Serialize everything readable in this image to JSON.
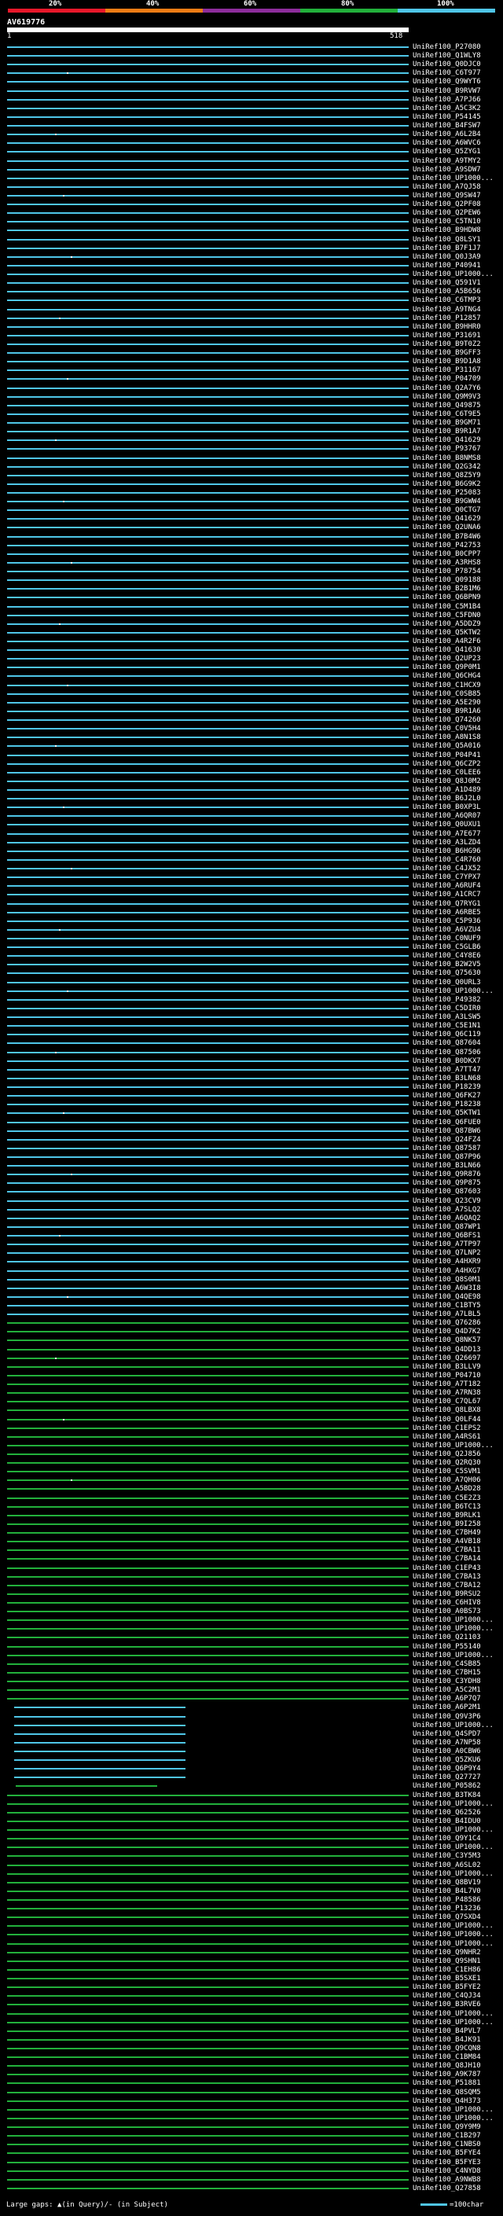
{
  "identity_scale": {
    "labels": [
      "20%",
      "40%",
      "60%",
      "80%",
      "100%"
    ],
    "colors": [
      "#e8182a",
      "#f07c15",
      "#8d2d9c",
      "#22b03b",
      "#4fc6e8"
    ]
  },
  "query": {
    "id": "AV619776",
    "start_label": "1",
    "end_label": "518"
  },
  "hits": [
    "UniRef100_P27080",
    "UniRef100_Q1WLY8",
    "UniRef100_Q0DJC0",
    "UniRef100_C6T977",
    "UniRef100_Q9WYT6",
    "UniRef100_B9RVW7",
    "UniRef100_A7PJ66",
    "UniRef100_A5C3K2",
    "UniRef100_P54145",
    "UniRef100_B4FSW7",
    "UniRef100_A6L2B4",
    "UniRef100_A6WVC6",
    "UniRef100_Q5ZYG1",
    "UniRef100_A9TMY2",
    "UniRef100_A9SDW7",
    "UniRef100_UP1000...",
    "UniRef100_A7QJ58",
    "UniRef100_Q9SW47",
    "UniRef100_Q2PF08",
    "UniRef100_Q2PEW6",
    "UniRef100_C5TN10",
    "UniRef100_B9HDW8",
    "UniRef100_Q8LSY1",
    "UniRef100_B7F1J7",
    "UniRef100_Q0J3A9",
    "UniRef100_P40941",
    "UniRef100_UP1000...",
    "UniRef100_Q591V1",
    "UniRef100_A5B656",
    "UniRef100_C6TMP3",
    "UniRef100_A9TNG4",
    "UniRef100_P12857",
    "UniRef100_B9HHR0",
    "UniRef100_P31691",
    "UniRef100_B9T0Z2",
    "UniRef100_B9GFF3",
    "UniRef100_B9D1A8",
    "UniRef100_P31167",
    "UniRef100_P04709",
    "UniRef100_Q2A7Y6",
    "UniRef100_Q9M9V3",
    "UniRef100_Q49875",
    "UniRef100_C6T9E5",
    "UniRef100_B9GM71",
    "UniRef100_B9R1A7",
    "UniRef100_Q41629",
    "UniRef100_P93767",
    "UniRef100_B8NMS8",
    "UniRef100_Q2G342",
    "UniRef100_Q8Z5Y9",
    "UniRef100_B6G9K2",
    "UniRef100_P25083",
    "UniRef100_B9GWW4",
    "UniRef100_Q0CTG7",
    "UniRef100_Q41629",
    "UniRef100_Q2UNA6",
    "UniRef100_B7B4W6",
    "UniRef100_P42753",
    "UniRef100_B0CPP7",
    "UniRef100_A3RHS8",
    "UniRef100_P78754",
    "UniRef100_Q09188",
    "UniRef100_B2B1M6",
    "UniRef100_Q6BPN9",
    "UniRef100_C5M1B4",
    "UniRef100_C5FDN0",
    "UniRef100_A5DDZ9",
    "UniRef100_Q5KTW2",
    "UniRef100_A4R2F6",
    "UniRef100_Q41630",
    "UniRef100_Q2UP23",
    "UniRef100_Q9P0M1",
    "UniRef100_Q6CHG4",
    "UniRef100_C1HCX9",
    "UniRef100_C0SB85",
    "UniRef100_A5E290",
    "UniRef100_B9R1A6",
    "UniRef100_Q74260",
    "UniRef100_C0V5H4",
    "UniRef100_A8N1S8",
    "UniRef100_Q5A016",
    "UniRef100_P04P41",
    "UniRef100_Q6CZP2",
    "UniRef100_C0LEE6",
    "UniRef100_Q8J0M2",
    "UniRef100_A1D489",
    "UniRef100_B6J2L0",
    "UniRef100_B0XP3L",
    "UniRef100_A6QR07",
    "UniRef100_Q0UXU1",
    "UniRef100_A7E677",
    "UniRef100_A3LZD4",
    "UniRef100_B6HG96",
    "UniRef100_C4R760",
    "UniRef100_C4JX52",
    "UniRef100_C7YPX7",
    "UniRef100_A6RUF4",
    "UniRef100_A1CRC7",
    "UniRef100_Q7RYG1",
    "UniRef100_A6RBE5",
    "UniRef100_C5P936",
    "UniRef100_A6VZU4",
    "UniRef100_C0NUF9",
    "UniRef100_C5GLB6",
    "UniRef100_C4Y8E6",
    "UniRef100_B2W2V5",
    "UniRef100_Q75630",
    "UniRef100_Q0URL3",
    "UniRef100_UP1000...",
    "UniRef100_P49382",
    "UniRef100_C5DIR0",
    "UniRef100_A3LSW5",
    "UniRef100_C5E1N1",
    "UniRef100_Q6C119",
    "UniRef100_Q87604",
    "UniRef100_Q87506",
    "UniRef100_B0DKX7",
    "UniRef100_A7TT47",
    "UniRef100_B3LN68",
    "UniRef100_P18239",
    "UniRef100_Q6FK27",
    "UniRef100_P18238",
    "UniRef100_Q5KTW1",
    "UniRef100_Q6FUE0",
    "UniRef100_Q87BW6",
    "UniRef100_Q24FZ4",
    "UniRef100_Q87587",
    "UniRef100_Q87P96",
    "UniRef100_B3LN66",
    "UniRef100_Q9R876",
    "UniRef100_Q9P875",
    "UniRef100_Q87603",
    "UniRef100_Q23CV9",
    "UniRef100_A7SLQ2",
    "UniRef100_A6QAQ2",
    "UniRef100_Q87WP1",
    "UniRef100_Q6BFS1",
    "UniRef100_A7TP97",
    "UniRef100_Q7LNP2",
    "UniRef100_A4HXR9",
    "UniRef100_A4HXG7",
    "UniRef100_Q8S0M1",
    "UniRef100_A6W3I8",
    "UniRef100_Q4QE98",
    "UniRef100_C1BTY5",
    "UniRef100_A7LBL5",
    "UniRef100_Q76286",
    "UniRef100_Q4D7K2",
    "UniRef100_Q8NK57",
    "UniRef100_Q4DD13",
    "UniRef100_Q26697",
    "UniRef100_B3LLV9",
    "UniRef100_P04710",
    "UniRef100_A7T182",
    "UniRef100_A7RN38",
    "UniRef100_C7QL67",
    "UniRef100_Q8LBX8",
    "UniRef100_Q0LF44",
    "UniRef100_C1EPS2",
    "UniRef100_A4RS61",
    "UniRef100_UP1000...",
    "UniRef100_Q2J856",
    "UniRef100_Q2RQ30",
    "UniRef100_C5SVM1",
    "UniRef100_A7QH06",
    "UniRef100_A5BD28",
    "UniRef100_C5E2Z3",
    "UniRef100_B6TC13",
    "UniRef100_B9RLK1",
    "UniRef100_B9I258",
    "UniRef100_C7BH49",
    "UniRef100_A4VB18",
    "UniRef100_C7BA11",
    "UniRef100_C7BA14",
    "UniRef100_C1EP43",
    "UniRef100_C7BA13",
    "UniRef100_C7BA12",
    "UniRef100_B9RSU2",
    "UniRef100_C6HIV8",
    "UniRef100_A0BS73",
    "UniRef100_UP1000...",
    "UniRef100_UP1000...",
    "UniRef100_Q21103",
    "UniRef100_P55140",
    "UniRef100_UP1000...",
    "UniRef100_C4SB85",
    "UniRef100_C7BH15",
    "UniRef100_C3YDH8",
    "UniRef100_A5C2M1",
    "UniRef100_A6P7Q7",
    "UniRef100_A6P2M1",
    "UniRef100_Q9V3P6",
    "UniRef100_UP1000...",
    "UniRef100_Q4SPD7",
    "UniRef100_A7NP58",
    "UniRef100_A0CBW6",
    "UniRef100_Q5ZKU6",
    "UniRef100_Q6P9Y4",
    "UniRef100_Q27727",
    "UniRef100_P05862",
    "UniRef100_B3TK84",
    "UniRef100_UP1000...",
    "UniRef100_Q62526",
    "UniRef100_B4IDU0",
    "UniRef100_UP1000...",
    "UniRef100_Q9Y1C4",
    "UniRef100_UP1000...",
    "UniRef100_C3Y5M3",
    "UniRef100_A6SL02",
    "UniRef100_UP1000...",
    "UniRef100_Q8BV19",
    "UniRef100_B4L7V0",
    "UniRef100_P48586",
    "UniRef100_P13236",
    "UniRef100_Q7SXD4",
    "UniRef100_UP1000...",
    "UniRef100_UP1000...",
    "UniRef100_UP1000...",
    "UniRef100_Q9NHR2",
    "UniRef100_Q9SHN1",
    "UniRef100_C1EH86",
    "UniRef100_B5SXE1",
    "UniRef100_B5FYE2",
    "UniRef100_C4QJ34",
    "UniRef100_B3RVE6",
    "UniRef100_UP1000...",
    "UniRef100_UP1000...",
    "UniRef100_B4PVL7",
    "UniRef100_B4JK91",
    "UniRef100_Q9CQN8",
    "UniRef100_C1BM84",
    "UniRef100_Q8JH10",
    "UniRef100_A9K787",
    "UniRef100_P51881",
    "UniRef100_Q8SQM5",
    "UniRef100_Q4H373",
    "UniRef100_UP1000...",
    "UniRef100_UP1000...",
    "UniRef100_Q9Y9M9",
    "UniRef100_C1B297",
    "UniRef100_C1NBS0",
    "UniRef100_B5FYE4",
    "UniRef100_B5FYE3",
    "UniRef100_C4NYD8",
    "UniRef100_A9NWB8",
    "UniRef100_Q27858"
  ],
  "legend": {
    "text": "Large gaps: ▲(in Query)/- (in Subject)",
    "scale": "=100char"
  }
}
